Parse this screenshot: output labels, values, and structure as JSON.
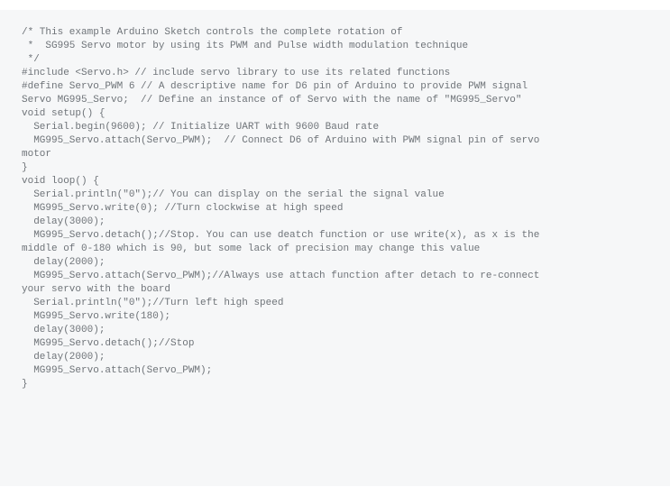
{
  "code": {
    "lines": [
      "/* This example Arduino Sketch controls the complete rotation of",
      " *  SG995 Servo motor by using its PWM and Pulse width modulation technique",
      " */",
      "",
      "#include <Servo.h> // include servo library to use its related functions",
      "#define Servo_PWM 6 // A descriptive name for D6 pin of Arduino to provide PWM signal",
      "Servo MG995_Servo;  // Define an instance of of Servo with the name of \"MG995_Servo\"",
      "",
      "",
      "void setup() {",
      "  Serial.begin(9600); // Initialize UART with 9600 Baud rate",
      "  MG995_Servo.attach(Servo_PWM);  // Connect D6 of Arduino with PWM signal pin of servo motor",
      "",
      "}",
      "",
      "void loop() {",
      "  Serial.println(\"0\");// You can display on the serial the signal value",
      "  MG995_Servo.write(0); //Turn clockwise at high speed",
      "  delay(3000);",
      "  MG995_Servo.detach();//Stop. You can use deatch function or use write(x), as x is the middle of 0-180 which is 90, but some lack of precision may change this value",
      "  delay(2000);",
      "  MG995_Servo.attach(Servo_PWM);//Always use attach function after detach to re-connect your servo with the board",
      "  Serial.println(\"0\");//Turn left high speed",
      "  MG995_Servo.write(180);",
      "  delay(3000);",
      "  MG995_Servo.detach();//Stop",
      "  delay(2000);",
      "  MG995_Servo.attach(Servo_PWM);",
      "",
      "",
      "}"
    ]
  }
}
